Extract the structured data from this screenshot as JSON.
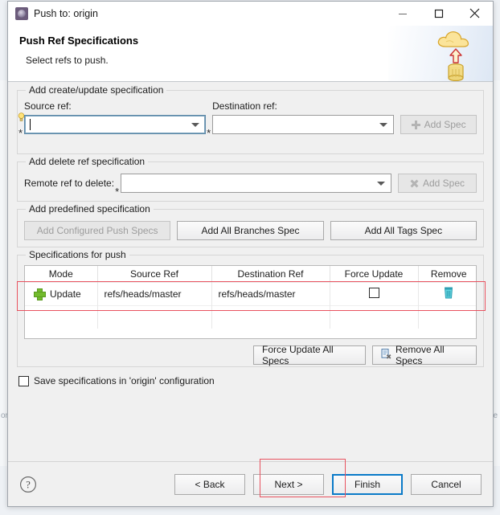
{
  "window": {
    "title": "Push to: origin",
    "icon": "git-push-window-icon",
    "controls": {
      "minimize": "minimize-icon",
      "maximize": "maximize-icon",
      "close": "close-icon"
    }
  },
  "banner": {
    "title": "Push Ref Specifications",
    "subtitle": "Select refs to push.",
    "icon": "cloud-push-database-icon"
  },
  "create_update_group": {
    "legend": "Add create/update specification",
    "source_label": "Source ref:",
    "source_value": "",
    "destination_label": "Destination ref:",
    "destination_value": "",
    "add_spec_label": "Add Spec",
    "add_spec_enabled": false,
    "required_marker": "*"
  },
  "delete_group": {
    "legend": "Add delete ref specification",
    "remote_label": "Remote ref to delete:",
    "remote_value": "",
    "add_spec_label": "Add Spec",
    "add_spec_enabled": false,
    "required_marker": "*"
  },
  "predefined_group": {
    "legend": "Add predefined specification",
    "buttons": [
      {
        "label": "Add Configured Push Specs",
        "enabled": false
      },
      {
        "label": "Add All Branches Spec",
        "enabled": true
      },
      {
        "label": "Add All Tags Spec",
        "enabled": true
      }
    ]
  },
  "specs_group": {
    "legend": "Specifications for push",
    "columns": [
      "Mode",
      "Source Ref",
      "Destination Ref",
      "Force Update",
      "Remove"
    ],
    "rows": [
      {
        "mode": "Update",
        "mode_icon": "green-plus-icon",
        "source_ref": "refs/heads/master",
        "destination_ref": "refs/heads/master",
        "force_update": false,
        "remove_icon": "trash-icon"
      }
    ],
    "actions": [
      {
        "label": "Force Update All Specs",
        "icon": "",
        "enabled": true
      },
      {
        "label": "Remove All Specs",
        "icon": "remove-all-specs-icon",
        "enabled": true
      }
    ]
  },
  "save_config": {
    "label": "Save specifications in 'origin' configuration",
    "checked": false
  },
  "footer": {
    "help_icon": "help-icon",
    "buttons": [
      {
        "label": "< Back",
        "default": false
      },
      {
        "label": "Next >",
        "default": false
      },
      {
        "label": "Finish",
        "default": true
      },
      {
        "label": "Cancel",
        "default": false
      }
    ]
  },
  "annotations": {
    "accent_color": "#e8525f",
    "boxes": [
      "specs-table-row-highlight",
      "next-button-highlight"
    ]
  },
  "colors": {
    "accent_red": "#e8525f",
    "default_button_border": "#0a7ac8",
    "green_plus": "#73bb2d",
    "trash_teal": "#3fb6c8",
    "dialog_bg": "#f0f0f0"
  }
}
